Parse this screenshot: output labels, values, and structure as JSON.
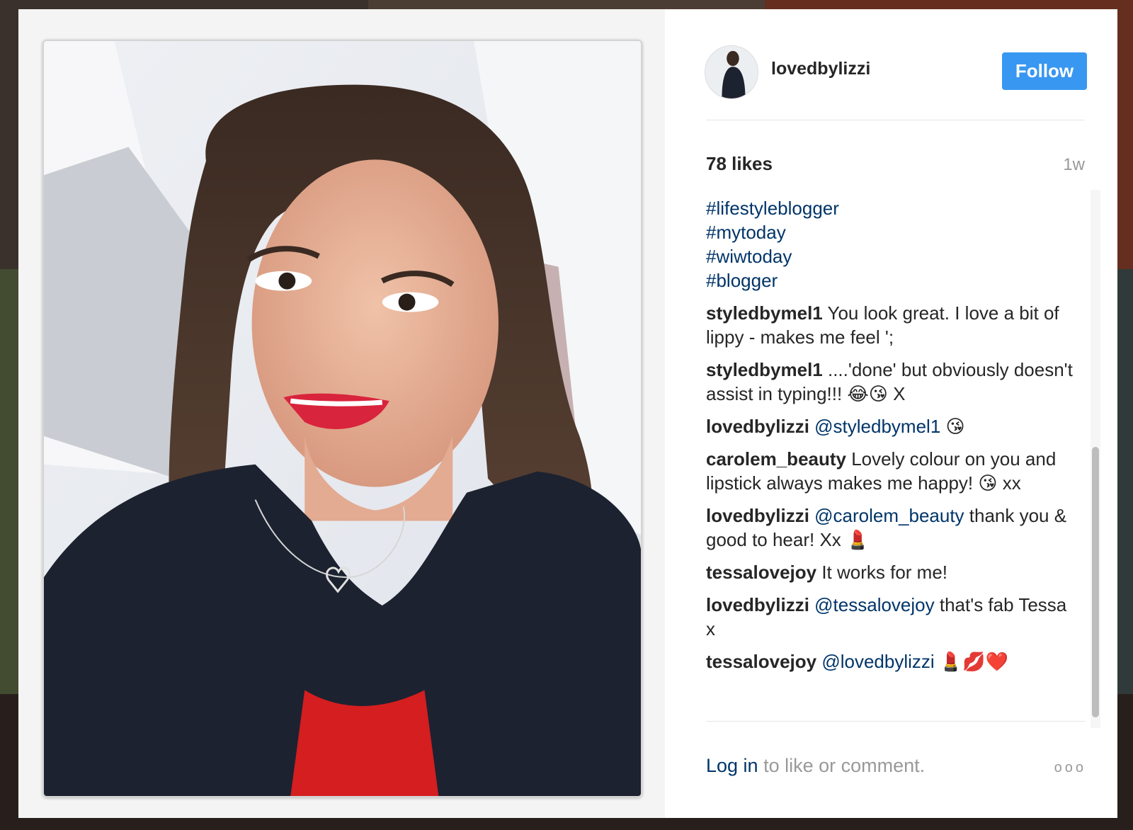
{
  "post": {
    "username": "lovedbylizzi",
    "follow_label": "Follow",
    "likes": "78 likes",
    "time": "1w",
    "hashtags": [
      "#lifestyleblogger",
      "#mytoday",
      "#wiwtoday",
      "#blogger"
    ],
    "comments": [
      {
        "user": "styledbymel1",
        "mention": "",
        "text": " You look great. I love a bit of lippy - makes me feel ';"
      },
      {
        "user": "styledbymel1",
        "mention": "",
        "text": " ....'done' but obviously doesn't assist in typing!!! 😂😘 X"
      },
      {
        "user": "lovedbylizzi",
        "mention": "@styledbymel1",
        "text": " 😘"
      },
      {
        "user": "carolem_beauty",
        "mention": "",
        "text": " Lovely colour on you and lipstick always makes me happy! 😘 xx"
      },
      {
        "user": "lovedbylizzi",
        "mention": "@carolem_beauty",
        "text": " thank you & good to hear! Xx 💄"
      },
      {
        "user": "tessalovejoy",
        "mention": "",
        "text": " It works for me!"
      },
      {
        "user": "lovedbylizzi",
        "mention": "@tessalovejoy",
        "text": " that's fab Tessa x"
      },
      {
        "user": "tessalovejoy",
        "mention": "@lovedbylizzi",
        "text": " 💄💋❤️"
      }
    ],
    "footer_login": "Log in",
    "footer_text": " to like or comment.",
    "more_label": "ooo"
  },
  "colors": {
    "accent": "#3897f0",
    "link": "#003569",
    "muted": "#999999"
  },
  "icons": {
    "more": "more-options-icon"
  }
}
